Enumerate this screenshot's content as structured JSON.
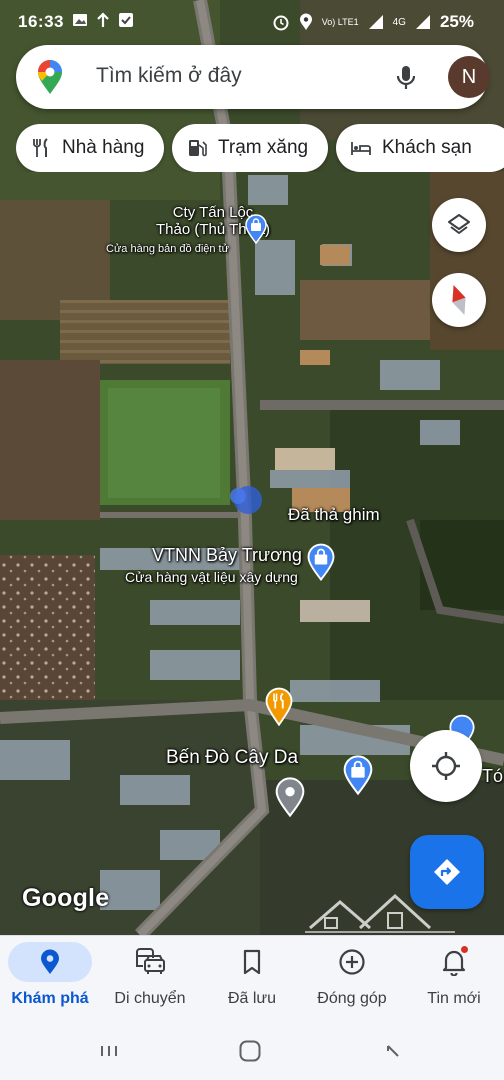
{
  "status_bar": {
    "time": "16:33",
    "signal": "Vo) LTE1",
    "network": "4G",
    "battery": "25%"
  },
  "search": {
    "placeholder": "Tìm kiếm ở đây",
    "avatar_letter": "N"
  },
  "chips": [
    {
      "label": "Nhà hàng",
      "icon": "fork-knife-icon"
    },
    {
      "label": "Trạm xăng",
      "icon": "gas-station-icon"
    },
    {
      "label": "Khách sạn",
      "icon": "bed-icon"
    }
  ],
  "map": {
    "places": [
      {
        "name": "Cty Tấn Lộc Thảo (Thủ Thừa)",
        "line1": "Cty Tấn Lộc",
        "line2": "Thảo (Thủ Thừa)",
        "category": "Cửa hàng bản đồ điện tử",
        "pin": "shopping-bag-pin"
      },
      {
        "name": "VTNN Bảy Trương",
        "category": "Cửa hàng vật liệu xây dựng",
        "pin": "shopping-bag-pin"
      },
      {
        "name": "Bến Đò Cây Da",
        "pin": "location-pin"
      }
    ],
    "dropped_pin_label": "Đã thả ghim",
    "edge_label": "Tó",
    "google_wordmark": "Google",
    "restaurant_pin": "restaurant-pin"
  },
  "bottom_nav": [
    {
      "label": "Khám phá",
      "icon": "explore-pin-icon",
      "active": true
    },
    {
      "label": "Di chuyển",
      "icon": "commute-icon",
      "active": false
    },
    {
      "label": "Đã lưu",
      "icon": "bookmark-icon",
      "active": false
    },
    {
      "label": "Đóng góp",
      "icon": "add-circle-icon",
      "active": false
    },
    {
      "label": "Tin mới",
      "icon": "bell-icon",
      "active": false,
      "badge": true
    }
  ],
  "colors": {
    "accent_blue": "#1a73e8",
    "active_nav_bg": "#d3e3fd",
    "active_nav_text": "#0b57d0",
    "pin_blue": "#4285f4",
    "pin_orange": "#f29900",
    "pin_gray": "#80868b"
  }
}
